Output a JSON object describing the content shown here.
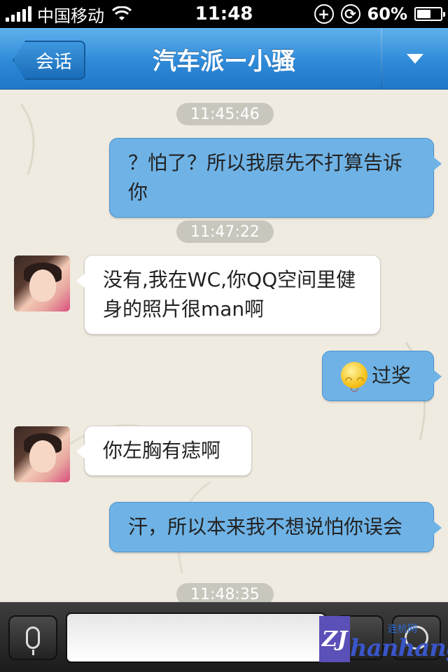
{
  "status_bar": {
    "carrier": "中国移动",
    "time": "11:48",
    "battery_percent": "60%",
    "battery_level": 0.6
  },
  "nav": {
    "back_label": "会话",
    "title": "汽车派ー小骚"
  },
  "messages": [
    {
      "kind": "timestamp",
      "text": "11:45:46"
    },
    {
      "kind": "outgoing",
      "text": "？怕了？所以我原先不打算告诉你"
    },
    {
      "kind": "timestamp",
      "text": "11:47:22"
    },
    {
      "kind": "incoming",
      "text": "没有,我在WC,你QQ空间里健身的照片很man啊"
    },
    {
      "kind": "outgoing",
      "text": "过奖",
      "emoji": "smile-emoji"
    },
    {
      "kind": "incoming",
      "text": "你左胸有痣啊"
    },
    {
      "kind": "outgoing",
      "text": "汗，所以本来我不想说怕你误会"
    },
    {
      "kind": "timestamp",
      "text": "11:48:35"
    }
  ],
  "watermark": {
    "badge": "ZJ",
    "text": "hanhang",
    "small": "连杭网"
  },
  "colors": {
    "nav_blue": "#2f8ad8",
    "outgoing_bubble": "#6fb3e6",
    "incoming_bubble": "#ffffff",
    "timestamp_pill": "#c9c6bd"
  }
}
